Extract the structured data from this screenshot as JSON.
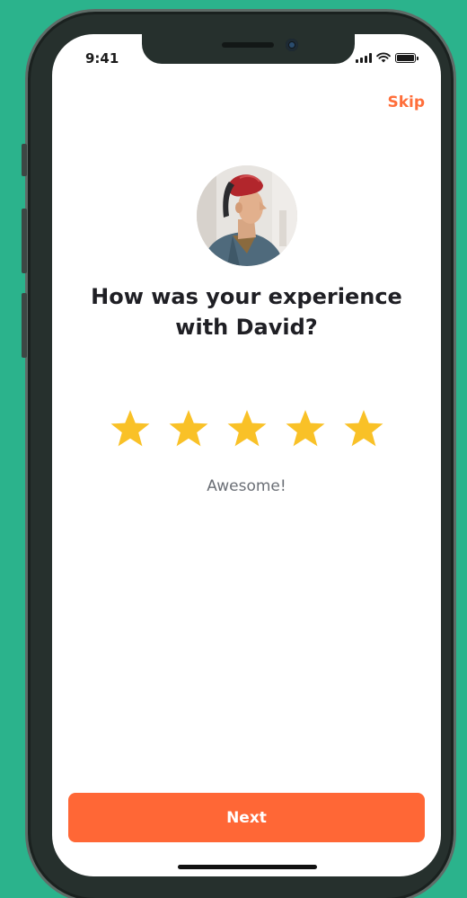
{
  "status_bar": {
    "time": "9:41",
    "icons": [
      "cellular-signal-icon",
      "wifi-icon",
      "battery-icon"
    ]
  },
  "header": {
    "skip_label": "Skip"
  },
  "profile": {
    "avatar_icon": "user-photo-avatar"
  },
  "question": {
    "line1": "How was your experience",
    "line2": "with David?"
  },
  "rating": {
    "max_stars": 5,
    "selected": 5,
    "label": "Awesome!"
  },
  "footer": {
    "next_label": "Next"
  },
  "colors": {
    "accent": "#ff6736",
    "skip_text": "#ff6e3a",
    "star": "#f9c127",
    "background": "#2bb38c",
    "title_text": "#1f1f24",
    "label_text": "#6b6f76"
  }
}
